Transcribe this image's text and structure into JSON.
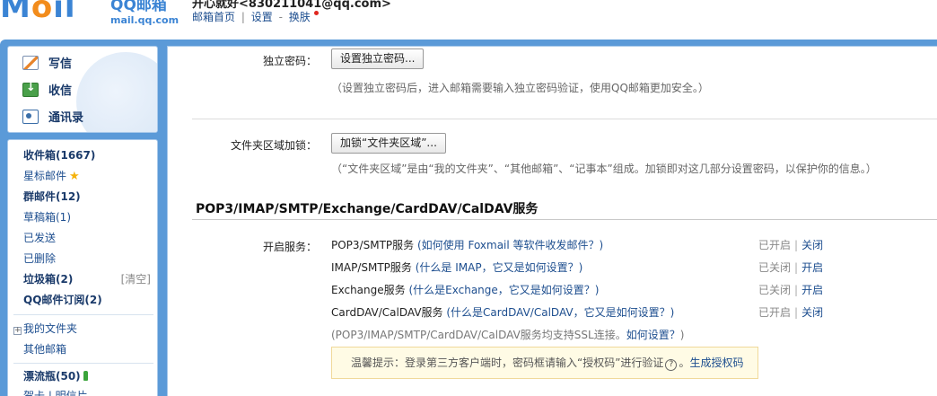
{
  "header": {
    "logo_text": "Mail",
    "logo_brand": "QQ邮箱",
    "logo_domain": "mail.qq.com",
    "user_display": "开心就好<830211041@qq.com>",
    "links": {
      "home": "邮箱首页",
      "sep": "|",
      "settings": "设置",
      "dash": "-",
      "skin": "换肤"
    }
  },
  "sidebar": {
    "compose": {
      "write": "写信",
      "receive": "收信",
      "contacts": "通讯录"
    },
    "folders": {
      "inbox": "收件箱(1667)",
      "starred": "星标邮件",
      "group": "群邮件(12)",
      "drafts": "草稿箱(1)",
      "sent": "已发送",
      "deleted": "已删除",
      "spam": "垃圾箱(2)",
      "spam_clear": "[清空]",
      "subscriptions": "QQ邮件订阅(2)",
      "my_folders": "我的文件夹",
      "other_mailboxes": "其他邮箱",
      "drift_bottle": "漂流瓶(50)",
      "more": "贺卡 | 明信片"
    }
  },
  "main": {
    "independent_password": {
      "label": "独立密码：",
      "button": "设置独立密码...",
      "hint": "（设置独立密码后，进入邮箱需要输入独立密码验证，使用QQ邮箱更加安全。）"
    },
    "folder_lock": {
      "label": "文件夹区域加锁：",
      "button": "加锁“文件夹区域”...",
      "hint": "（“文件夹区域”是由“我的文件夹”、“其他邮箱”、“记事本”组成。加锁即对这几部分设置密码，以保护你的信息。）"
    },
    "services": {
      "title": "POP3/IMAP/SMTP/Exchange/CardDAV/CalDAV服务",
      "label": "开启服务：",
      "items": [
        {
          "name": "POP3/SMTP服务",
          "help": "(如何使用 Foxmail 等软件收发邮件？)",
          "status": "已开启",
          "sep": "|",
          "action": "关闭"
        },
        {
          "name": "IMAP/SMTP服务",
          "help": "(什么是 IMAP，它又是如何设置？)",
          "status": "已关闭",
          "sep": "|",
          "action": "开启"
        },
        {
          "name": "Exchange服务",
          "help": "(什么是Exchange，它又是如何设置？)",
          "status": "已关闭",
          "sep": "|",
          "action": "开启"
        },
        {
          "name": "CardDAV/CalDAV服务",
          "help": "(什么是CardDAV/CalDAV，它又是如何设置？)",
          "status": "已开启",
          "sep": "|",
          "action": "关闭"
        }
      ],
      "ssl_note": "(POP3/IMAP/SMTP/CardDAV/CalDAV服务均支持SSL连接。",
      "ssl_link": "如何设置？",
      "ssl_close": ")",
      "tip_text": "温馨提示：登录第三方客户端时，密码框请输入“授权码”进行验证",
      "tip_icon": "?",
      "tip_after": "。",
      "tip_link": "生成授权码"
    }
  }
}
